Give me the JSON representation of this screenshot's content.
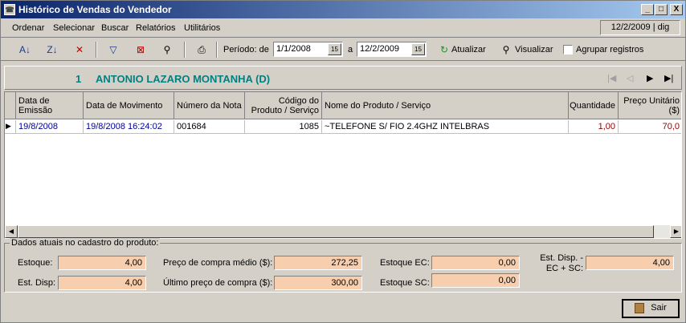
{
  "window": {
    "title": "Histórico de Vendas do Vendedor",
    "min": "_",
    "max": "□",
    "close": "X"
  },
  "menu": {
    "items": [
      "Ordenar",
      "Selecionar",
      "Buscar",
      "Relatórios",
      "Utilitários"
    ],
    "date_user": "12/2/2009 | dig"
  },
  "toolbar": {
    "periodo_label": "Período: de",
    "from": "1/1/2008",
    "a_label": "a",
    "to": "12/2/2009",
    "atualizar": "Atualizar",
    "visualizar": "Visualizar",
    "agrupar": "Agrupar registros",
    "picker": "15"
  },
  "vendor": {
    "number": "1",
    "name": "ANTONIO LAZARO MONTANHA (D)"
  },
  "grid": {
    "headers": [
      "Data de Emissão",
      "Data de Movimento",
      "Número da Nota",
      "Código do Produto / Serviço",
      "Nome do Produto / Serviço",
      "Quantidade",
      "Preço Unitário ($)"
    ],
    "rows": [
      {
        "emissao": "19/8/2008",
        "movimento": "19/8/2008 16:24:02",
        "nota": "001684",
        "codigo": "1085",
        "nome": "~TELEFONE S/ FIO 2.4GHZ INTELBRAS",
        "quantidade": "1,00",
        "preco": "70,0"
      }
    ]
  },
  "produto": {
    "group_title": "Dados atuais no cadastro do produto:",
    "estoque_label": "Estoque:",
    "estoque": "4,00",
    "est_disp_label": "Est. Disp:",
    "est_disp": "4,00",
    "preco_medio_label": "Preço de compra médio ($):",
    "preco_medio": "272,25",
    "ultimo_preco_label": "Último preço de compra ($):",
    "ultimo_preco": "300,00",
    "estoque_ec_label": "Estoque EC:",
    "estoque_ec": "0,00",
    "estoque_sc_label": "Estoque SC:",
    "estoque_sc": "0,00",
    "est_disp_total_label1": "Est. Disp. -",
    "est_disp_total_label2": "EC + SC:",
    "est_disp_total": "4,00"
  },
  "footer": {
    "sair": "Sair"
  }
}
